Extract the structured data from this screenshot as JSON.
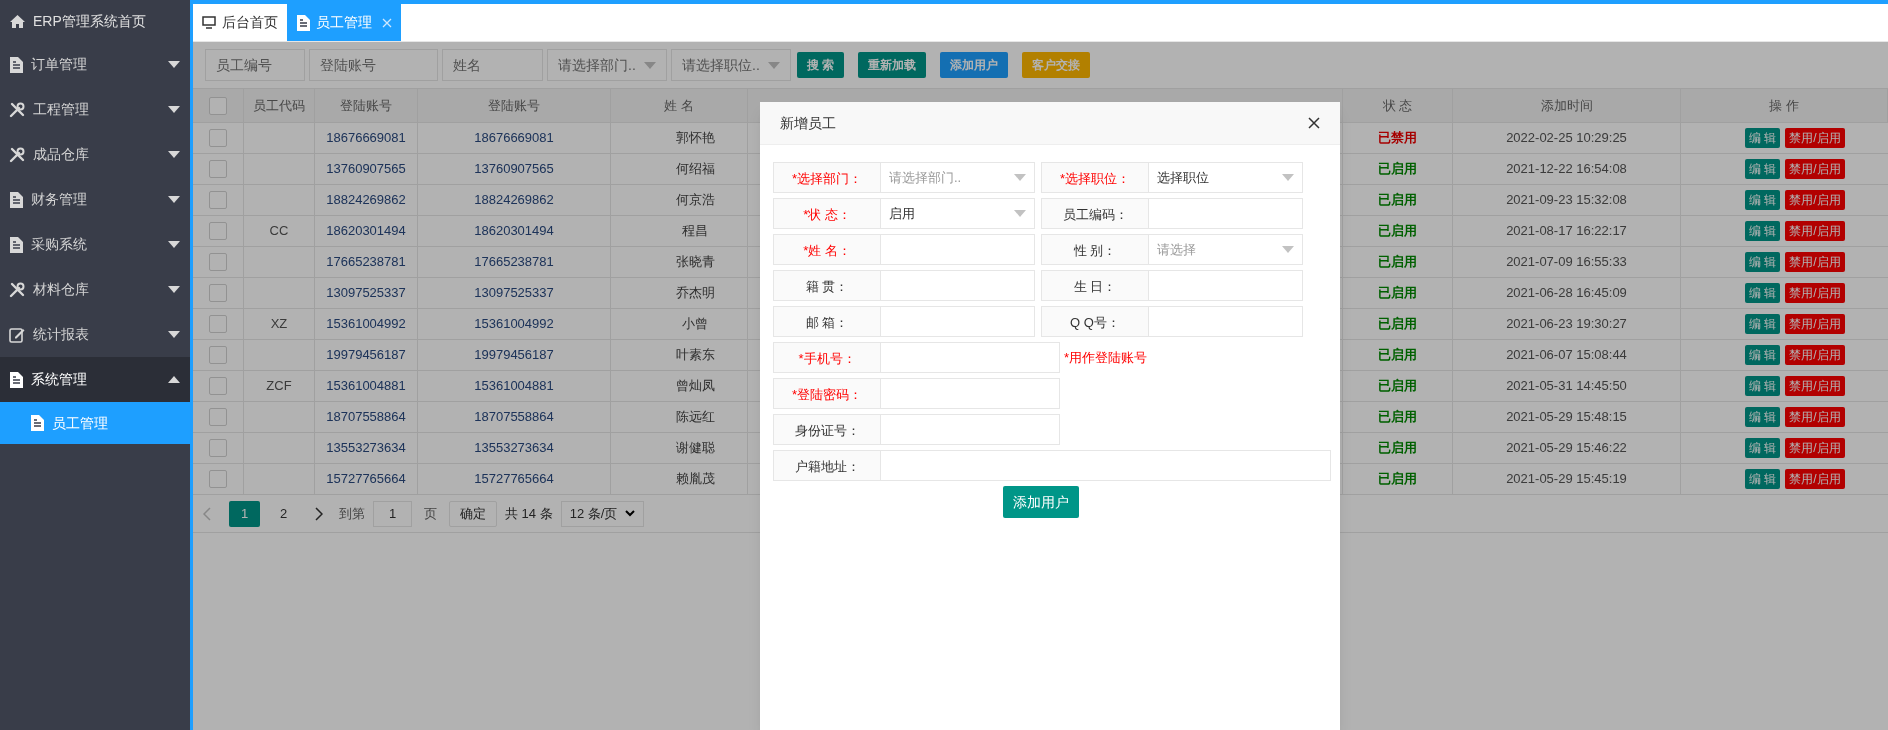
{
  "sidebar": {
    "title": "ERP管理系统首页",
    "items": [
      {
        "label": "订单管理",
        "kind": "document",
        "expanded": false
      },
      {
        "label": "工程管理",
        "kind": "tools",
        "expanded": false
      },
      {
        "label": "成品仓库",
        "kind": "tools",
        "expanded": false
      },
      {
        "label": "财务管理",
        "kind": "document",
        "expanded": false
      },
      {
        "label": "采购系统",
        "kind": "document",
        "expanded": false
      },
      {
        "label": "材料仓库",
        "kind": "tools",
        "expanded": false
      },
      {
        "label": "统计报表",
        "kind": "report",
        "expanded": false
      },
      {
        "label": "系统管理",
        "kind": "document",
        "expanded": true,
        "children": [
          {
            "label": "员工管理",
            "selected": true
          }
        ]
      }
    ]
  },
  "tabs": [
    {
      "label": "后台首页",
      "kind": "monitor",
      "selected": false,
      "closable": false
    },
    {
      "label": "员工管理",
      "kind": "document",
      "selected": true,
      "closable": true
    }
  ],
  "toolbar": {
    "filters": [
      {
        "placeholder": "员工编号",
        "kind": "input"
      },
      {
        "placeholder": "登陆账号",
        "kind": "input"
      },
      {
        "placeholder": "姓名",
        "kind": "input"
      },
      {
        "placeholder": "请选择部门..",
        "kind": "select"
      },
      {
        "placeholder": "请选择职位..",
        "kind": "select"
      }
    ],
    "buttons": [
      {
        "label": "搜 索",
        "kind": "teal"
      },
      {
        "label": "重新加载",
        "kind": "teal"
      },
      {
        "label": "添加用户",
        "kind": "blue"
      },
      {
        "label": "客户交接",
        "kind": "orange"
      }
    ]
  },
  "table": {
    "all_checked": false,
    "columns": [
      "员工代码",
      "登陆账号",
      "登陆账号",
      "姓 名",
      "状 态",
      "添加时间",
      "操 作"
    ],
    "rows": [
      {
        "checked": false,
        "code": "",
        "account": "18676669081",
        "account_2": "18676669081",
        "name": "郭怀艳",
        "status": "已禁用",
        "enabled": false,
        "added": "2022-02-25 10:29:25",
        "actions": [
          "编 辑",
          "禁用/启用"
        ]
      },
      {
        "checked": false,
        "code": "",
        "account": "13760907565",
        "account_2": "13760907565",
        "name": "何绍福",
        "status": "已启用",
        "enabled": true,
        "added": "2021-12-22 16:54:08",
        "actions": [
          "编 辑",
          "禁用/启用"
        ]
      },
      {
        "checked": false,
        "code": "",
        "account": "18824269862",
        "account_2": "18824269862",
        "name": "何京浩",
        "status": "已启用",
        "enabled": true,
        "added": "2021-09-23 15:32:08",
        "actions": [
          "编 辑",
          "禁用/启用"
        ]
      },
      {
        "checked": false,
        "code": "CC",
        "account": "18620301494",
        "account_2": "18620301494",
        "name": "程昌",
        "status": "已启用",
        "enabled": true,
        "added": "2021-08-17 16:22:17",
        "actions": [
          "编 辑",
          "禁用/启用"
        ]
      },
      {
        "checked": false,
        "code": "",
        "account": "17665238781",
        "account_2": "17665238781",
        "name": "张晓青",
        "status": "已启用",
        "enabled": true,
        "added": "2021-07-09 16:55:33",
        "actions": [
          "编 辑",
          "禁用/启用"
        ]
      },
      {
        "checked": false,
        "code": "",
        "account": "13097525337",
        "account_2": "13097525337",
        "name": "乔杰明",
        "status": "已启用",
        "enabled": true,
        "added": "2021-06-28 16:45:09",
        "actions": [
          "编 辑",
          "禁用/启用"
        ]
      },
      {
        "checked": false,
        "code": "XZ",
        "account": "15361004992",
        "account_2": "15361004992",
        "name": "小曾",
        "status": "已启用",
        "enabled": true,
        "added": "2021-06-23 19:30:27",
        "actions": [
          "编 辑",
          "禁用/启用"
        ]
      },
      {
        "checked": false,
        "code": "",
        "account": "19979456187",
        "account_2": "19979456187",
        "name": "叶素东",
        "status": "已启用",
        "enabled": true,
        "added": "2021-06-07 15:08:44",
        "actions": [
          "编 辑",
          "禁用/启用"
        ]
      },
      {
        "checked": false,
        "code": "ZCF",
        "account": "15361004881",
        "account_2": "15361004881",
        "name": "曾灿凤",
        "status": "已启用",
        "enabled": true,
        "added": "2021-05-31 14:45:50",
        "actions": [
          "编 辑",
          "禁用/启用"
        ]
      },
      {
        "checked": false,
        "code": "",
        "account": "18707558864",
        "account_2": "18707558864",
        "name": "陈远红",
        "status": "已启用",
        "enabled": true,
        "added": "2021-05-29 15:48:15",
        "actions": [
          "编 辑",
          "禁用/启用"
        ]
      },
      {
        "checked": false,
        "code": "",
        "account": "13553273634",
        "account_2": "13553273634",
        "name": "谢健聪",
        "status": "已启用",
        "enabled": true,
        "added": "2021-05-29 15:46:22",
        "actions": [
          "编 辑",
          "禁用/启用"
        ]
      },
      {
        "checked": false,
        "code": "",
        "account": "15727765664",
        "account_2": "15727765664",
        "name": "赖胤茂",
        "status": "已启用",
        "enabled": true,
        "added": "2021-05-29 15:45:19",
        "actions": [
          "编 辑",
          "禁用/启用"
        ]
      }
    ]
  },
  "pagination": {
    "pages": [
      {
        "label": "1",
        "selected": true
      },
      {
        "label": "2",
        "selected": false
      }
    ],
    "goto_label": "到第",
    "goto_value": "1",
    "page_unit": "页",
    "confirm": "确定",
    "total": "共 14 条",
    "page_size": "12 条/页"
  },
  "modal": {
    "title": "新增员工",
    "rows": [
      {
        "kind": "pair",
        "fields": [
          {
            "label": "*选择部门：",
            "required": true,
            "kind": "select",
            "placeholder": "请选择部门.."
          },
          {
            "label": "*选择职位：",
            "required": true,
            "kind": "select",
            "value": "选择职位"
          }
        ]
      },
      {
        "kind": "pair",
        "fields": [
          {
            "label": "*状 态：",
            "required": true,
            "kind": "select",
            "value": "启用"
          },
          {
            "label": "员工编码：",
            "required": false,
            "kind": "input"
          }
        ]
      },
      {
        "kind": "pair",
        "fields": [
          {
            "label": "*姓 名：",
            "required": true,
            "kind": "input"
          },
          {
            "label": "性 别：",
            "required": false,
            "kind": "select",
            "placeholder": "请选择"
          }
        ]
      },
      {
        "kind": "pair",
        "fields": [
          {
            "label": "籍 贯：",
            "required": false,
            "kind": "input"
          },
          {
            "label": "生 日：",
            "required": false,
            "kind": "input"
          }
        ]
      },
      {
        "kind": "pair",
        "fields": [
          {
            "label": "邮 箱：",
            "required": false,
            "kind": "input"
          },
          {
            "label": "Q Q号：",
            "required": false,
            "kind": "input"
          }
        ]
      },
      {
        "kind": "single",
        "fields": [
          {
            "label": "*手机号：",
            "required": true,
            "kind": "input"
          }
        ],
        "note": "*用作登陆账号"
      },
      {
        "kind": "single",
        "fields": [
          {
            "label": "*登陆密码：",
            "required": true,
            "kind": "input"
          }
        ]
      },
      {
        "kind": "single",
        "fields": [
          {
            "label": "身份证号：",
            "required": false,
            "kind": "input"
          }
        ]
      },
      {
        "kind": "full",
        "fields": [
          {
            "label": "户籍地址：",
            "required": false,
            "kind": "input"
          }
        ]
      }
    ],
    "submit": "添加用户"
  }
}
